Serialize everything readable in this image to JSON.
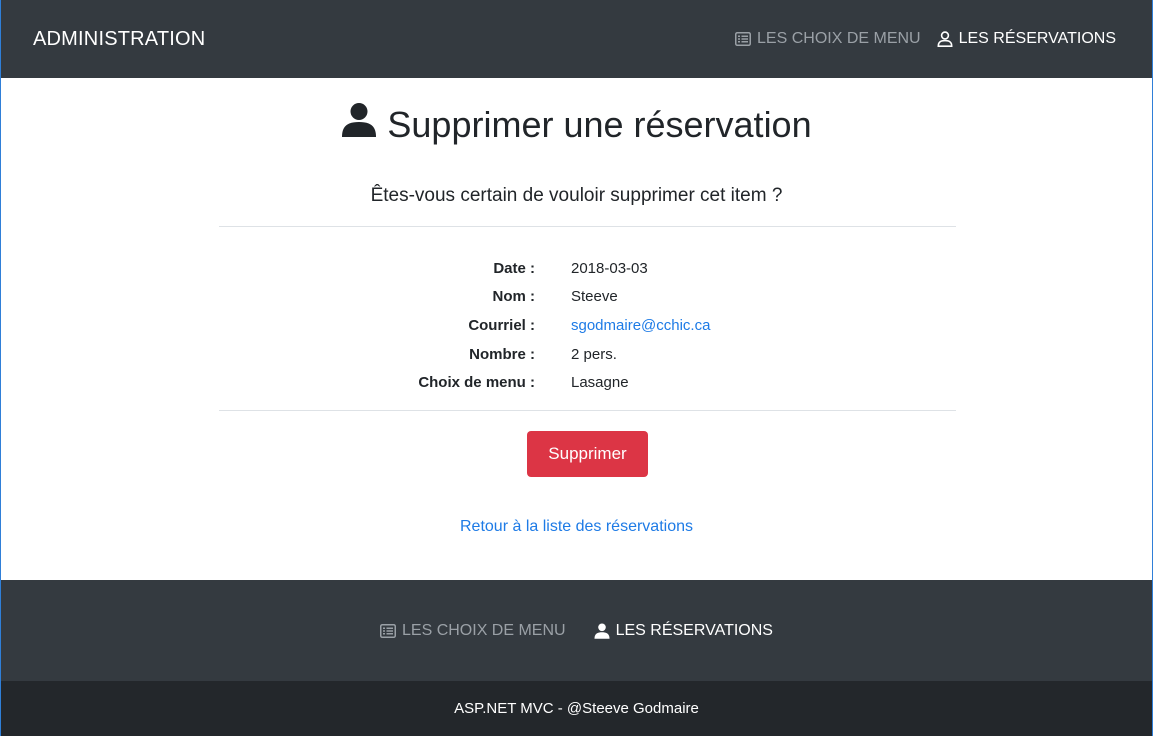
{
  "navbar": {
    "brand": "ADMINISTRATION",
    "links": [
      {
        "label": "LES CHOIX DE MENU",
        "icon": "list-icon",
        "active": false
      },
      {
        "label": "LES RÉSERVATIONS",
        "icon": "user-icon",
        "active": true
      }
    ]
  },
  "page": {
    "title": "Supprimer une réservation",
    "title_icon": "user-icon",
    "confirm_text": "Êtes-vous certain de vouloir supprimer cet item ?"
  },
  "details": [
    {
      "label": "Date :",
      "value": "2018-03-03"
    },
    {
      "label": "Nom :",
      "value": "Steeve"
    },
    {
      "label": "Courriel :",
      "value": "sgodmaire@cchic.ca",
      "link": true
    },
    {
      "label": "Nombre :",
      "value": "2 pers."
    },
    {
      "label": "Choix de menu :",
      "value": "Lasagne"
    }
  ],
  "actions": {
    "delete_label": "Supprimer",
    "back_label": "Retour à la liste des réservations"
  },
  "footer": {
    "links": [
      {
        "label": "LES CHOIX DE MENU",
        "icon": "list-icon",
        "active": false
      },
      {
        "label": "LES RÉSERVATIONS",
        "icon": "user-icon",
        "active": true
      }
    ],
    "copyright": "ASP.NET MVC - @Steeve Godmaire"
  },
  "colors": {
    "navbar_bg": "#343a40",
    "footer_bottom_bg": "#23272b",
    "danger": "#dc3545",
    "link": "#1e7be6"
  }
}
